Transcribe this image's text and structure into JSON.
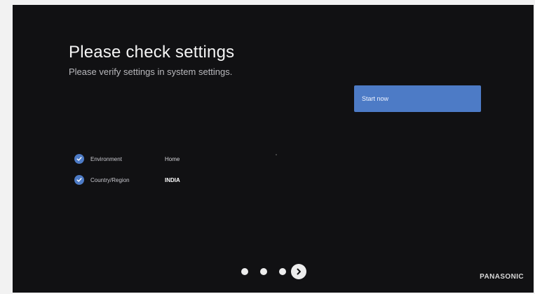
{
  "screen": {
    "title": "Please check settings",
    "subtitle": "Please verify settings in system settings."
  },
  "actions": {
    "start_label": "Start now"
  },
  "settings": [
    {
      "label": "Environment",
      "value": "Home",
      "checked": true
    },
    {
      "label": "Country/Region",
      "value": "INDIA",
      "checked": true
    }
  ],
  "pager": {
    "dot_count": 3,
    "next_icon": "chevron-right-icon"
  },
  "brand": {
    "name": "PANASONIC"
  },
  "colors": {
    "background": "#111113",
    "accent": "#4d7bc6",
    "text": "#f4f4f4"
  }
}
